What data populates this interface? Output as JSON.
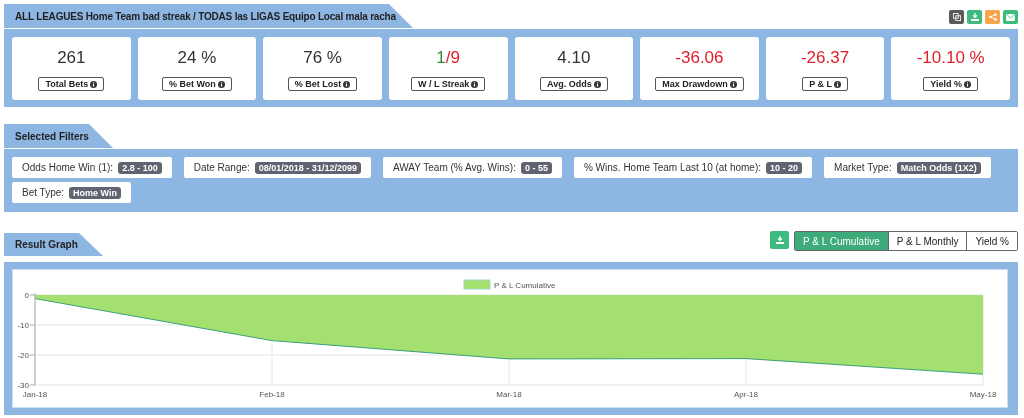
{
  "header": {
    "title": "ALL LEAGUES Home Team bad streak / TODAS las LIGAS Equipo Local mala racha"
  },
  "actions": [
    {
      "kind": "copy",
      "color": "#5a5a5a"
    },
    {
      "kind": "download",
      "color": "#3dbb7e"
    },
    {
      "kind": "share",
      "color": "#f6a54a"
    },
    {
      "kind": "email",
      "color": "#3dbb7e"
    }
  ],
  "stats": [
    {
      "label": "Total Bets",
      "parts": [
        {
          "text": "261",
          "color": "#333333"
        }
      ]
    },
    {
      "label": "% Bet Won",
      "parts": [
        {
          "text": "24 %",
          "color": "#333333"
        }
      ]
    },
    {
      "label": "% Bet Lost",
      "parts": [
        {
          "text": "76 %",
          "color": "#333333"
        }
      ]
    },
    {
      "label": "W / L Streak",
      "parts": [
        {
          "text": "1",
          "color": "#3a8a3a"
        },
        {
          "text": "/9",
          "color": "#e0202a"
        }
      ]
    },
    {
      "label": "Avg. Odds",
      "parts": [
        {
          "text": "4.10",
          "color": "#333333"
        }
      ]
    },
    {
      "label": "Max Drawdown",
      "parts": [
        {
          "text": "-36.06",
          "color": "#e0202a"
        }
      ]
    },
    {
      "label": "P & L",
      "parts": [
        {
          "text": "-26.37",
          "color": "#e0202a"
        }
      ]
    },
    {
      "label": "Yield %",
      "parts": [
        {
          "text": "-10.10 %",
          "color": "#e0202a"
        }
      ]
    }
  ],
  "filters_section": {
    "title": "Selected Filters"
  },
  "filters": [
    {
      "label": "Odds Home Win (1):",
      "value": "2.8 - 100"
    },
    {
      "label": "Date Range:",
      "value": "08/01/2018 - 31/12/2099"
    },
    {
      "label": "AWAY Team (% Avg. Wins):",
      "value": "0 - 55"
    },
    {
      "label": "% Wins. Home Team Last 10 (at home):",
      "value": "10 - 20"
    },
    {
      "label": "Market Type:",
      "value": "Match Odds (1X2)"
    },
    {
      "label": "Bet Type:",
      "value": "Home Win"
    }
  ],
  "graph_section": {
    "title": "Result Graph"
  },
  "graph_tabs": [
    {
      "label": "P & L Cumulative",
      "selected": true
    },
    {
      "label": "P & L Monthly",
      "selected": false
    },
    {
      "label": "Yield %",
      "selected": false
    }
  ],
  "chart_data": {
    "type": "area",
    "categories": [
      "Jan-18",
      "Feb-18",
      "Mar-18",
      "Apr-18",
      "May-18"
    ],
    "series": [
      {
        "name": "P & L Cumulative",
        "color": "#a3e070",
        "values": [
          -1.2,
          -15.2,
          -21.3,
          -21.2,
          -26.4
        ]
      }
    ],
    "ylim": [
      -30,
      0
    ],
    "yticks": [
      0,
      -10,
      -20,
      -30
    ],
    "grid": true
  }
}
